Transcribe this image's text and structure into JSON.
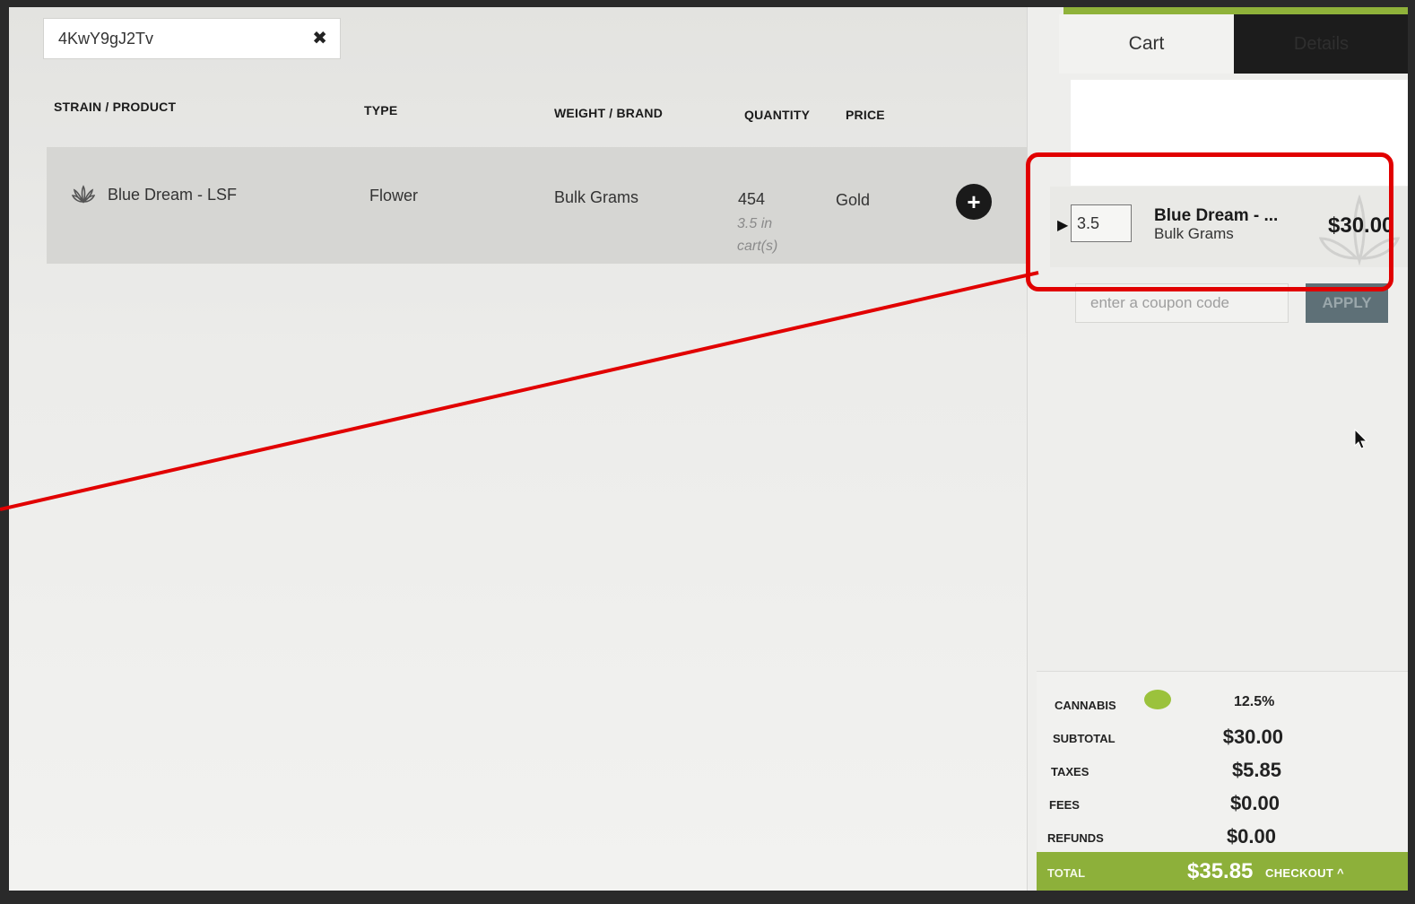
{
  "search": {
    "value": "4KwY9gJ2Tv"
  },
  "table": {
    "headers": [
      "STRAIN / PRODUCT",
      "TYPE",
      "WEIGHT / BRAND",
      "QUANTITY",
      "PRICE"
    ],
    "rows": [
      {
        "product": "Blue Dream - LSF",
        "type": "Flower",
        "weight_brand": "Bulk Grams",
        "quantity": "454",
        "in_cart_line1": "3.5 in",
        "in_cart_line2": "cart(s)",
        "price": "Gold"
      }
    ]
  },
  "panel": {
    "tabs": {
      "cart": "Cart",
      "details": "Details"
    },
    "cart_item": {
      "quantity": "3.5",
      "name": "Blue Dream - ...",
      "brand": "Bulk Grams",
      "price": "$30.00"
    },
    "coupon": {
      "placeholder": "enter a coupon code",
      "apply": "APPLY"
    },
    "summary": {
      "cannabis_label": "CANNABIS",
      "cannabis_pct": "12.5%",
      "subtotal_label": "SUBTOTAL",
      "subtotal": "$30.00",
      "taxes_label": "TAXES",
      "taxes": "$5.85",
      "fees_label": "FEES",
      "fees": "$0.00",
      "refunds_label": "REFUNDS",
      "refunds": "$0.00",
      "total_label": "TOTAL",
      "total": "$35.85",
      "checkout": "CHECKOUT ^"
    }
  },
  "colors": {
    "accent_green": "#8db03a",
    "cannabis_dot": "#9bc23c",
    "highlight_red": "#e10000",
    "apply_button": "#5e7077"
  },
  "icons": [
    "clear-icon",
    "cannabis-leaf-icon",
    "plus-icon",
    "caret-right-icon",
    "cursor-icon"
  ]
}
